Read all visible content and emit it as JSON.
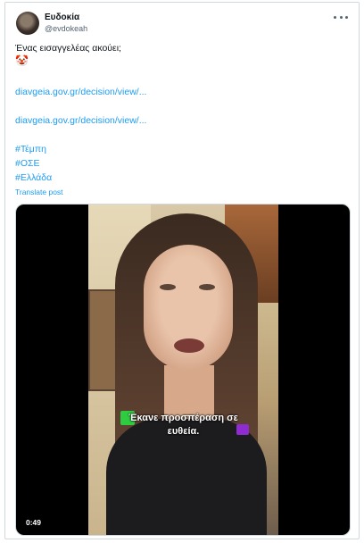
{
  "post": {
    "display_name": "Ευδοκία",
    "handle": "@evdokeah",
    "line1": "Ένας εισαγγελέας ακούει;",
    "emoji": "🤡",
    "link1": "diavgeia.gov.gr/decision/view/...",
    "link2": "diavgeia.gov.gr/decision/view/...",
    "hashtags": [
      "#Τέμπη",
      "#ΟΣΕ",
      "#Ελλάδα"
    ],
    "translate_label": "Translate post"
  },
  "video": {
    "subtitle_line1": "Έκανε προσπέραση σε",
    "subtitle_line2": "ευθεία.",
    "timestamp": "0:49"
  }
}
